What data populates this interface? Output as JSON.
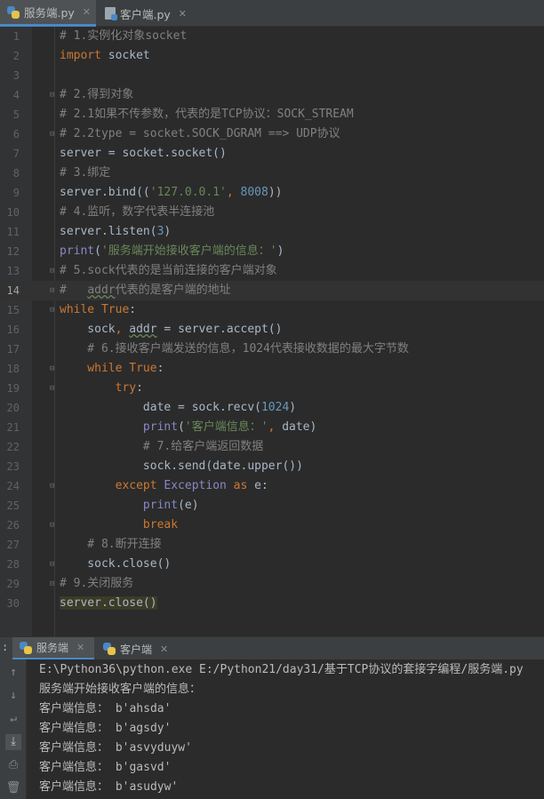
{
  "editor_tabs": [
    {
      "label": "服务端.py",
      "active": true
    },
    {
      "label": "客户端.py",
      "active": false
    }
  ],
  "code_lines": [
    {
      "n": "1",
      "parts": [
        {
          "t": "# 1.实例化对象socket",
          "c": "cm"
        }
      ]
    },
    {
      "n": "2",
      "parts": [
        {
          "t": "import",
          "c": "kw"
        },
        {
          "t": " socket",
          "c": ""
        }
      ]
    },
    {
      "n": "3",
      "parts": []
    },
    {
      "n": "4",
      "parts": [
        {
          "t": "# 2.得到对象",
          "c": "cm"
        }
      ]
    },
    {
      "n": "5",
      "parts": [
        {
          "t": "# 2.1如果不传参数，代表的是TCP协议：SOCK_STREAM",
          "c": "cm"
        }
      ]
    },
    {
      "n": "6",
      "parts": [
        {
          "t": "# 2.2type = socket.SOCK_DGRAM ==> UDP协议",
          "c": "cm"
        }
      ]
    },
    {
      "n": "7",
      "parts": [
        {
          "t": "server = socket.socket()",
          "c": ""
        }
      ]
    },
    {
      "n": "8",
      "parts": [
        {
          "t": "# 3.绑定",
          "c": "cm"
        }
      ]
    },
    {
      "n": "9",
      "parts": [
        {
          "t": "server.bind((",
          "c": ""
        },
        {
          "t": "'127.0.0.1'",
          "c": "str"
        },
        {
          "t": ", ",
          "c": "kw"
        },
        {
          "t": "8008",
          "c": "num"
        },
        {
          "t": "))",
          "c": ""
        }
      ]
    },
    {
      "n": "10",
      "parts": [
        {
          "t": "# 4.监听，数字代表半连接池",
          "c": "cm"
        }
      ]
    },
    {
      "n": "11",
      "parts": [
        {
          "t": "server.listen(",
          "c": ""
        },
        {
          "t": "3",
          "c": "num"
        },
        {
          "t": ")",
          "c": ""
        }
      ]
    },
    {
      "n": "12",
      "parts": [
        {
          "t": "print",
          "c": "bi"
        },
        {
          "t": "(",
          "c": ""
        },
        {
          "t": "'服务端开始接收客户端的信息：'",
          "c": "str"
        },
        {
          "t": ")",
          "c": ""
        }
      ]
    },
    {
      "n": "13",
      "parts": [
        {
          "t": "# 5.sock代表的是当前连接的客户端对象",
          "c": "cm"
        }
      ]
    },
    {
      "n": "14",
      "parts": [
        {
          "t": "#   ",
          "c": "cm"
        },
        {
          "t": "addr",
          "c": "cm squig"
        },
        {
          "t": "代表的是客户端的地址",
          "c": "cm"
        }
      ],
      "current": true
    },
    {
      "n": "15",
      "parts": [
        {
          "t": "while",
          "c": "kw"
        },
        {
          "t": " True",
          "c": "kw"
        },
        {
          "t": ":",
          "c": ""
        }
      ]
    },
    {
      "n": "16",
      "parts": [
        {
          "t": "    sock",
          "c": ""
        },
        {
          "t": ", ",
          "c": "kw"
        },
        {
          "t": "addr",
          "c": "squig"
        },
        {
          "t": " = server.accept()",
          "c": ""
        }
      ]
    },
    {
      "n": "17",
      "parts": [
        {
          "t": "    # 6.接收客户端发送的信息，1024代表接收数据的最大字节数",
          "c": "cm"
        }
      ]
    },
    {
      "n": "18",
      "parts": [
        {
          "t": "    while",
          "c": "kw"
        },
        {
          "t": " True",
          "c": "kw"
        },
        {
          "t": ":",
          "c": ""
        }
      ]
    },
    {
      "n": "19",
      "parts": [
        {
          "t": "        try",
          "c": "kw"
        },
        {
          "t": ":",
          "c": ""
        }
      ]
    },
    {
      "n": "20",
      "parts": [
        {
          "t": "            date = sock.recv(",
          "c": ""
        },
        {
          "t": "1024",
          "c": "num"
        },
        {
          "t": ")",
          "c": ""
        }
      ]
    },
    {
      "n": "21",
      "parts": [
        {
          "t": "            print",
          "c": "bi"
        },
        {
          "t": "(",
          "c": ""
        },
        {
          "t": "'客户端信息：'",
          "c": "str"
        },
        {
          "t": ", ",
          "c": "kw"
        },
        {
          "t": "date)",
          "c": ""
        }
      ]
    },
    {
      "n": "22",
      "parts": [
        {
          "t": "            # 7.给客户端返回数据",
          "c": "cm"
        }
      ]
    },
    {
      "n": "23",
      "parts": [
        {
          "t": "            sock.send(date.upper())",
          "c": ""
        }
      ]
    },
    {
      "n": "24",
      "parts": [
        {
          "t": "        except",
          "c": "kw"
        },
        {
          "t": " Exception ",
          "c": "bi"
        },
        {
          "t": "as",
          "c": "kw"
        },
        {
          "t": " e:",
          "c": ""
        }
      ]
    },
    {
      "n": "25",
      "parts": [
        {
          "t": "            print",
          "c": "bi"
        },
        {
          "t": "(e)",
          "c": ""
        }
      ]
    },
    {
      "n": "26",
      "parts": [
        {
          "t": "            break",
          "c": "kw"
        }
      ]
    },
    {
      "n": "27",
      "parts": [
        {
          "t": "    # 8.断开连接",
          "c": "cm"
        }
      ]
    },
    {
      "n": "28",
      "parts": [
        {
          "t": "    sock.close()",
          "c": ""
        }
      ]
    },
    {
      "n": "29",
      "parts": [
        {
          "t": "# 9.关闭服务",
          "c": "cm"
        }
      ]
    },
    {
      "n": "30",
      "parts": [
        {
          "t": "server.close()",
          "c": "hl"
        }
      ]
    }
  ],
  "run_tabs": [
    {
      "label": "服务端",
      "active": true
    },
    {
      "label": "客户端",
      "active": false
    }
  ],
  "console_lines": [
    "E:\\Python36\\python.exe E:/Python21/day31/基于TCP协议的套接字编程/服务端.py",
    "服务端开始接收客户端的信息：",
    "客户端信息： b'ahsda'",
    "客户端信息： b'agsdy'",
    "客户端信息： b'asvyduyw'",
    "客户端信息： b'gasvd'",
    "客户端信息： b'asudyw'"
  ],
  "console_tools": [
    "up-arrow-icon",
    "down-arrow-icon",
    "soft-wrap-icon",
    "scroll-to-end-icon",
    "print-icon",
    "trash-icon"
  ]
}
